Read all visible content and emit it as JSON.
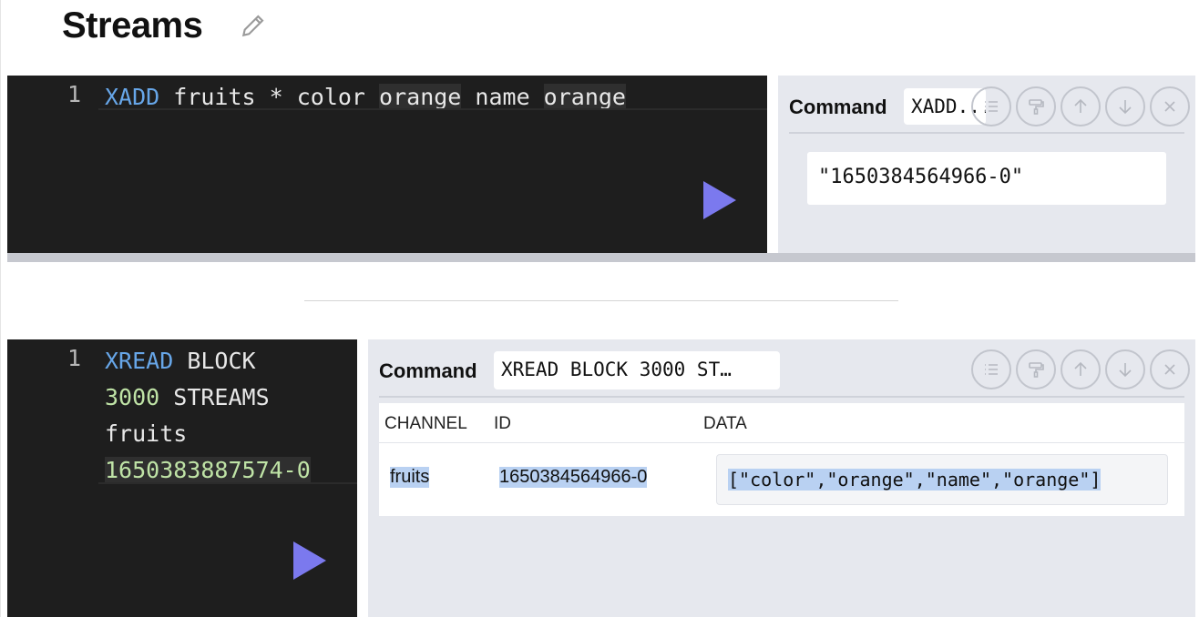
{
  "page": {
    "title": "Streams"
  },
  "cell1": {
    "line_number": "1",
    "code": {
      "keyword": "XADD",
      "plain": " fruits * color ",
      "h1": "orange",
      "mid": " name ",
      "h2": "orange"
    },
    "result": {
      "command_label": "Command",
      "command_value": "XADD...",
      "output": "\"1650384564966-0\""
    }
  },
  "cell2": {
    "line_number": "1",
    "code": {
      "line1_kw": "XREAD",
      "line1_rest": " BLOCK",
      "line2_num": "3000",
      "line2_rest": " STREAMS",
      "line3": "fruits",
      "line4": "1650383887574-0"
    },
    "result": {
      "command_label": "Command",
      "command_value": "XREAD BLOCK 3000 ST…",
      "table": {
        "headers": [
          "CHANNEL",
          "ID",
          "DATA"
        ],
        "rows": [
          {
            "channel": "fruits",
            "id": "1650384564966-0",
            "data": "[\"color\",\"orange\",\"name\",\"orange\"]"
          }
        ]
      }
    }
  },
  "toolbar_icons": [
    "list-icon",
    "paint-roller-icon",
    "arrow-up-icon",
    "arrow-down-icon",
    "close-icon"
  ],
  "colors": {
    "editor_bg": "#1e1e1e",
    "keyword": "#67a6e8",
    "number": "#bfe3a6",
    "run_button": "#7b79ee",
    "result_bg": "#e6e8ee",
    "selection": "#b9d1f2"
  }
}
